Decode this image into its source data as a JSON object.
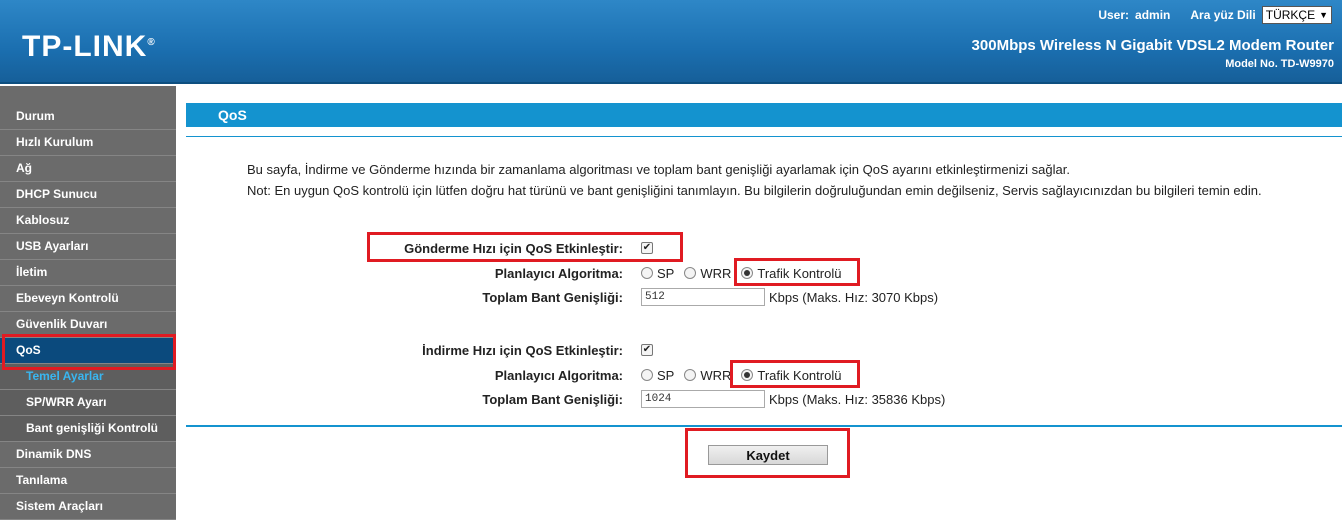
{
  "header": {
    "logo": "TP-LINK",
    "user_label": "User:",
    "user_name": "admin",
    "lang_label": "Ara yüz Dili",
    "lang_value": "TÜRKÇE",
    "product_title": "300Mbps Wireless N Gigabit VDSL2 Modem Router",
    "model_no": "Model No. TD-W9970"
  },
  "sidebar": {
    "items": [
      {
        "label": "Durum"
      },
      {
        "label": "Hızlı Kurulum"
      },
      {
        "label": "Ağ"
      },
      {
        "label": "DHCP Sunucu"
      },
      {
        "label": "Kablosuz"
      },
      {
        "label": "USB Ayarları"
      },
      {
        "label": "İletim"
      },
      {
        "label": "Ebeveyn Kontrolü"
      },
      {
        "label": "Güvenlik Duvarı"
      },
      {
        "label": "QoS"
      },
      {
        "label": "Temel Ayarlar"
      },
      {
        "label": "SP/WRR Ayarı"
      },
      {
        "label": "Bant genişliği Kontrolü"
      },
      {
        "label": "Dinamik DNS"
      },
      {
        "label": "Tanılama"
      },
      {
        "label": "Sistem Araçları"
      }
    ]
  },
  "main": {
    "title": "QoS",
    "description": "Bu sayfa, İndirme ve Gönderme hızında bir zamanlama algoritması ve toplam bant genişliği ayarlamak için QoS ayarını etkinleştirmenizi sağlar.",
    "note": "Not: En uygun QoS kontrolü için lütfen doğru hat türünü ve bant genişliğini tanımlayın. Bu bilgilerin doğruluğundan emin değilseniz, Servis sağlayıcınızdan bu bilgileri temin edin.",
    "upload": {
      "enable_label": "Gönderme Hızı için QoS Etkinleştir:",
      "algo_label": "Planlayıcı Algoritma:",
      "bw_label": "Toplam Bant Genişliği:",
      "bw_value": "512",
      "bw_hint": "Kbps (Maks. Hız: 3070 Kbps)"
    },
    "download": {
      "enable_label": "İndirme Hızı için QoS Etkinleştir:",
      "algo_label": "Planlayıcı Algoritma:",
      "bw_label": "Toplam Bant Genişliği:",
      "bw_value": "1024",
      "bw_hint": "Kbps (Maks. Hız: 35836 Kbps)"
    },
    "algo_options": {
      "sp": "SP",
      "wrr": "WRR",
      "tc": "Trafik Kontrolü"
    },
    "save_label": "Kaydet"
  },
  "colors": {
    "header": "#1b6fb0",
    "accent": "#1493cf",
    "sidebar": "#6b6b6b",
    "active": "#0b4a7d",
    "highlight": "#e01b22"
  }
}
